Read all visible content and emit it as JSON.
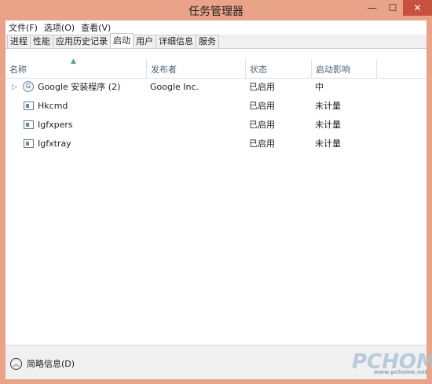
{
  "window": {
    "title": "任务管理器"
  },
  "menu": [
    "文件(F)",
    "选项(O)",
    "查看(V)"
  ],
  "tabs": [
    "进程",
    "性能",
    "应用历史记录",
    "启动",
    "用户",
    "详细信息",
    "服务"
  ],
  "active_tab": "启动",
  "columns": {
    "name": "名称",
    "publisher": "发布者",
    "status": "状态",
    "impact": "启动影响"
  },
  "rows": [
    {
      "name": "Google 安装程序 (2)",
      "publisher": "Google Inc.",
      "status": "已启用",
      "impact": "中",
      "icon": "google-installer-icon",
      "expandable": true
    },
    {
      "name": "Hkcmd",
      "publisher": "",
      "status": "已启用",
      "impact": "未计量",
      "icon": "app-window-icon",
      "expandable": false
    },
    {
      "name": "Igfxpers",
      "publisher": "",
      "status": "已启用",
      "impact": "未计量",
      "icon": "app-window-icon",
      "expandable": false
    },
    {
      "name": "Igfxtray",
      "publisher": "",
      "status": "已启用",
      "impact": "未计量",
      "icon": "app-window-icon",
      "expandable": false
    }
  ],
  "footer": {
    "fewer_details": "简略信息(D)"
  },
  "watermark": {
    "logo": "PCHOME",
    "url": "www.pchome.net"
  },
  "colors": {
    "titlebar": "#e9a389",
    "close_button": "#c7503f",
    "header_text": "#4c607a"
  }
}
